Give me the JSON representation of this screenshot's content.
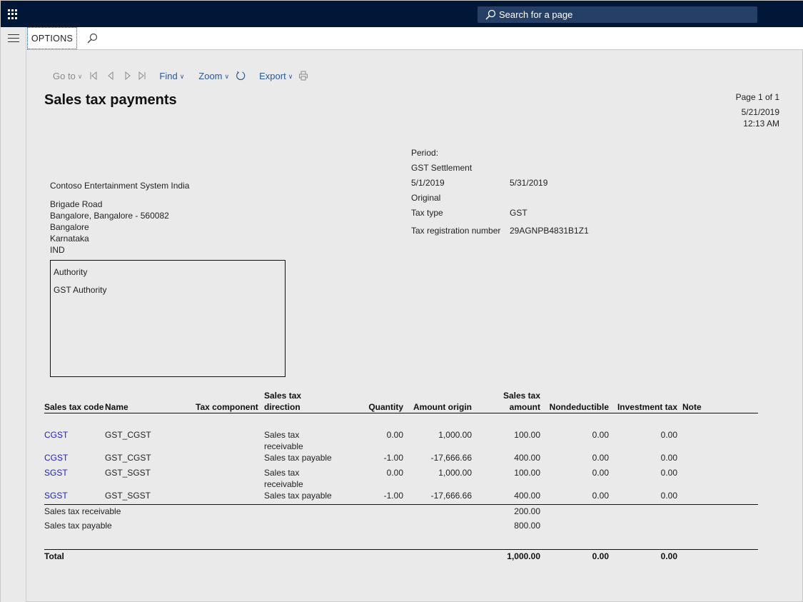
{
  "topbar": {
    "search_placeholder": "Search for a page"
  },
  "actionbar": {
    "options_label": "OPTIONS"
  },
  "report_toolbar": {
    "goto_label": "Go to",
    "find_label": "Find",
    "zoom_label": "Zoom",
    "export_label": "Export"
  },
  "report": {
    "title": "Sales tax payments",
    "page_info": "Page 1 of 1",
    "print_date": "5/21/2019",
    "print_time": "12:13 AM",
    "company": {
      "name": "Contoso Entertainment System India",
      "address_lines": [
        "Brigade Road",
        "Bangalore, Bangalore - 560082",
        "Bangalore",
        "Karnataka",
        "IND"
      ]
    },
    "authority": {
      "label": "Authority",
      "value": "GST Authority"
    },
    "period": {
      "label": "Period:",
      "settlement": "GST Settlement",
      "from_date": "5/1/2019",
      "to_date": "5/31/2019",
      "version": "Original",
      "tax_type_label": "Tax type",
      "tax_type_value": "GST",
      "tax_reg_label": "Tax registration number",
      "tax_reg_value": "29AGNPB4831B1Z1"
    },
    "columns": {
      "code": "Sales tax code",
      "name": "Name",
      "component": "Tax component",
      "direction_1": "Sales tax",
      "direction_2": "direction",
      "quantity": "Quantity",
      "amount_origin": "Amount origin",
      "tax_amount_1": "Sales tax",
      "tax_amount_2": "amount",
      "nondeductible": "Nondeductible",
      "investment": "Investment tax",
      "note": "Note"
    },
    "rows": [
      {
        "code": "CGST",
        "name": "GST_CGST",
        "component": "",
        "direction_1": "Sales tax",
        "direction_2": "receivable",
        "quantity": "0.00",
        "amount_origin": "1,000.00",
        "tax_amount": "100.00",
        "nondeductible": "0.00",
        "investment": "0.00",
        "note": ""
      },
      {
        "code": "CGST",
        "name": "GST_CGST",
        "component": "",
        "direction_1": "Sales tax payable",
        "direction_2": "",
        "quantity": "-1.00",
        "amount_origin": "-17,666.66",
        "tax_amount": "400.00",
        "nondeductible": "0.00",
        "investment": "0.00",
        "note": ""
      },
      {
        "code": "SGST",
        "name": "GST_SGST",
        "component": "",
        "direction_1": "Sales tax",
        "direction_2": "receivable",
        "quantity": "0.00",
        "amount_origin": "1,000.00",
        "tax_amount": "100.00",
        "nondeductible": "0.00",
        "investment": "0.00",
        "note": ""
      },
      {
        "code": "SGST",
        "name": "GST_SGST",
        "component": "",
        "direction_1": "Sales tax payable",
        "direction_2": "",
        "quantity": "-1.00",
        "amount_origin": "-17,666.66",
        "tax_amount": "400.00",
        "nondeductible": "0.00",
        "investment": "0.00",
        "note": ""
      }
    ],
    "summary": [
      {
        "label": "Sales tax receivable",
        "value": "200.00"
      },
      {
        "label": "Sales tax payable",
        "value": "800.00"
      }
    ],
    "total": {
      "label": "Total",
      "tax_amount": "1,000.00",
      "nondeductible": "0.00",
      "investment": "0.00"
    }
  }
}
